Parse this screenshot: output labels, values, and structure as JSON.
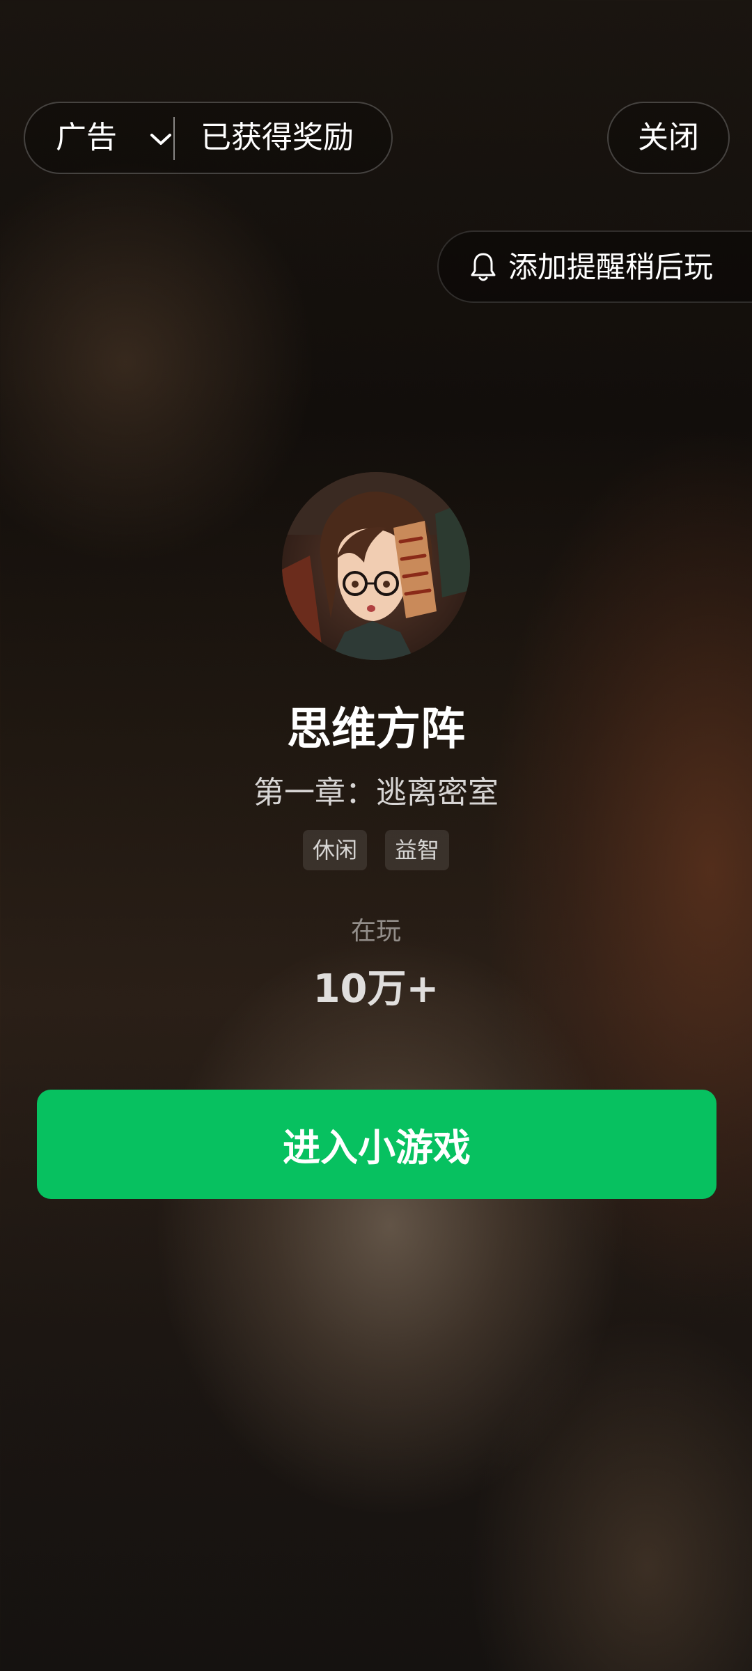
{
  "top_bar": {
    "ad_label": "广告",
    "reward_label": "已获得奖励",
    "close_label": "关闭"
  },
  "reminder": {
    "label": "添加提醒稍后玩",
    "icon": "bell-icon"
  },
  "game": {
    "avatar_icon": "game-avatar-image",
    "title": "思维方阵",
    "subtitle": "第一章：逃离密室",
    "tags": [
      "休闲",
      "益智"
    ],
    "playing_label": "在玩",
    "playing_count": "10万+"
  },
  "cta": {
    "label": "进入小游戏",
    "color": "#07c160"
  }
}
